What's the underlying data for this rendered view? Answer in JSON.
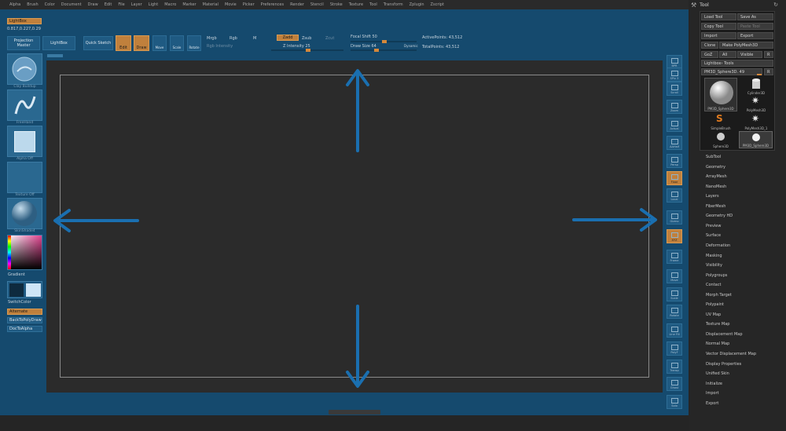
{
  "menu": [
    "Alpha",
    "Brush",
    "Color",
    "Document",
    "Draw",
    "Edit",
    "File",
    "Layer",
    "Light",
    "Macro",
    "Marker",
    "Material",
    "Movie",
    "Picker",
    "Preferences",
    "Render",
    "Stencil",
    "Stroke",
    "Texture",
    "Tool",
    "Transform",
    "Zplugin",
    "Zscript"
  ],
  "toolbar": {
    "lightbox": "LightBox",
    "coords": "0.817,0.227,0.29",
    "projection_master": "Projection Master",
    "lightbox_btn": "LightBox",
    "quick_sketch": "Quick Sketch",
    "edit": "Edit",
    "draw": "Draw",
    "move": "Move",
    "scale": "Scale",
    "rotate": "Rotate",
    "mrgb": "Mrgb",
    "rgb": "Rgb",
    "m": "M",
    "rgb_intensity": "Rgb Intensity",
    "zadd": "Zadd",
    "zsub": "Zsub",
    "zcut": "Zcut",
    "z_intensity": "Z Intensity 25",
    "focal_shift": "Focal Shift 50",
    "draw_size": "Draw Size 64",
    "dynamic": "Dynamic",
    "active_points": "ActivePoints: 43,512",
    "total_points": "TotalPoints: 43,512"
  },
  "left": {
    "brush": "Clay Buildup",
    "stroke": "FreeHand",
    "alpha": "Alpha Off",
    "texture": "Texture Off",
    "material": "SkinShade4",
    "gradient": "Gradient",
    "switch_color": "SwitchColor",
    "alternate": "Alternate",
    "backto": "BackToPolyDraw",
    "doc_alpha": "DocToAlpha"
  },
  "shelf": [
    "BPR",
    "SPix 3",
    "Scroll",
    "Zoom",
    "Actual",
    "AAHalf",
    "Persp",
    "Floor",
    "Local",
    "Gizmo",
    "XYZ",
    "Frame",
    "Move",
    "Scale",
    "Rotate",
    "Line Fill",
    "PolyF",
    "Transp",
    "Ghost",
    "Solo",
    "Xpose"
  ],
  "tool": {
    "title": "Tool",
    "load": "Load Tool",
    "save": "Save As",
    "copy": "Copy Tool",
    "paste": "Paste Tool",
    "import": "Import",
    "export": "Export",
    "clone": "Clone",
    "make_polymesh": "Make PolyMesh3D",
    "goz": "GoZ",
    "all": "All",
    "visible": "Visible",
    "r": "R",
    "lightbox_tools": "Lightbox› Tools",
    "current": "PM3D_Sphere3D. 49",
    "thumbs": [
      "PM3D_Sphere3D",
      "Cylinder3D",
      "PolyMesh3D",
      "SimpleBrush",
      "PolyMesh3D_1",
      "Sphere3D",
      "PM3D_Sphere3D"
    ],
    "subpalettes": [
      "SubTool",
      "Geometry",
      "ArrayMesh",
      "NanoMesh",
      "Layers",
      "FiberMesh",
      "Geometry HD",
      "Preview",
      "Surface",
      "Deformation",
      "Masking",
      "Visibility",
      "Polygroups",
      "Contact",
      "Morph Target",
      "Polypaint",
      "UV Map",
      "Texture Map",
      "Displacement Map",
      "Normal Map",
      "Vector Displacement Map",
      "Display Properties",
      "Unified Skin",
      "Initialize",
      "Import",
      "Export"
    ]
  },
  "colors": {
    "accent": "#1a6fb0",
    "workspace": "#154a6e",
    "orange": "#c0803c"
  }
}
